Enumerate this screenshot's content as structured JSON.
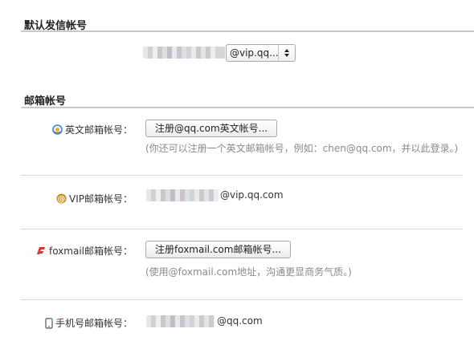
{
  "default_sender": {
    "title": "默认发信帐号",
    "selected_domain": "@vip.qq...",
    "icon": "chevron-updown-icon"
  },
  "mailbox_accounts": {
    "title": "邮箱帐号",
    "english": {
      "label": "英文邮箱帐号：",
      "icon": "qq-globe-icon",
      "button": "注册@qq.com英文帐号...",
      "hint": "(你还可以注册一个英文邮箱帐号，例如：chen@qq.com，并以此登录。)"
    },
    "vip": {
      "label": "VIP邮箱帐号：",
      "icon": "at-icon",
      "value_suffix": "@vip.qq.com"
    },
    "foxmail": {
      "label": "foxmail邮箱帐号：",
      "icon": "foxmail-icon",
      "button": "注册foxmail.com邮箱帐号...",
      "hint": "(使用@foxmail.com地址，沟通更显商务气质。)"
    },
    "mobile": {
      "label": "手机号邮箱帐号：",
      "icon": "mobile-phone-icon",
      "value_suffix": "@qq.com"
    }
  },
  "colors": {
    "section_line": "#c9c9c9",
    "hint_text": "#8a8a8a",
    "foxmail_red": "#e0352b",
    "at_orange": "#d08a1a",
    "qq_blue": "#2b8fd6"
  }
}
